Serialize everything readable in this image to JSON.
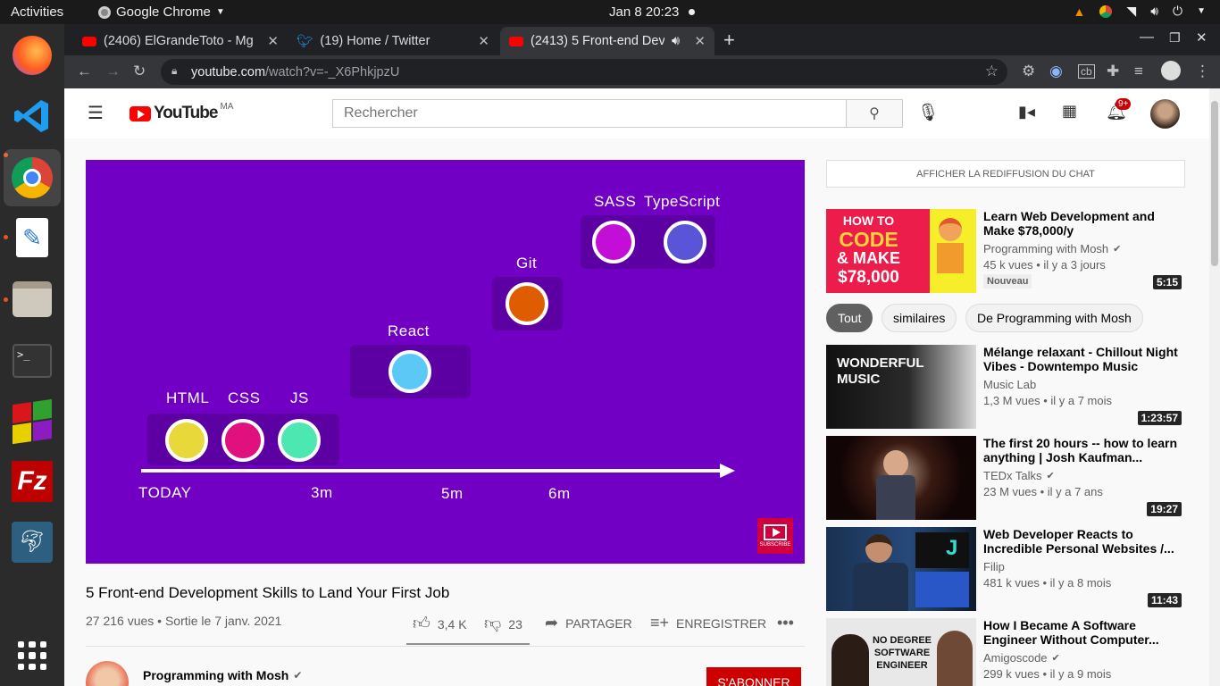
{
  "topbar": {
    "activities": "Activities",
    "app_name": "Google Chrome",
    "clock": "Jan 8  20:23"
  },
  "browser": {
    "tabs": [
      {
        "label": "(2406) ElGrandeToto - Mg",
        "icon": "youtube-icon"
      },
      {
        "label": "(19) Home / Twitter",
        "icon": "twitter-icon"
      },
      {
        "label": "(2413) 5 Front-end Dev",
        "icon": "youtube-icon",
        "active": true
      }
    ],
    "url_host": "youtube.com",
    "url_path": "/watch?v=-_X6PhkjpzU"
  },
  "youtube": {
    "logo": "YouTube",
    "region": "MA",
    "search_placeholder": "Rechercher",
    "notifications": "9+",
    "video": {
      "title": "5 Front-end Development Skills to Land Your First Job",
      "meta": "27 216 vues • Sortie le 7 janv. 2021",
      "likes": "3,4 K",
      "dislikes": "23",
      "share": "PARTAGER",
      "save": "ENREGISTRER",
      "channel": "Programming with Mosh",
      "subscribe": "S'ABONNER"
    },
    "player": {
      "labels": {
        "html": "HTML",
        "css": "CSS",
        "js": "JS",
        "react": "React",
        "git": "Git",
        "sass": "SASS",
        "ts": "TypeScript"
      },
      "timeline": {
        "today": "TODAY",
        "m3": "3m",
        "m5": "5m",
        "m6": "6m"
      },
      "subscribe_small": "SUBSCRIBE",
      "colors": {
        "bg": "#7100c4",
        "html": "#e8d83a",
        "css": "#e0107f",
        "js": "#4de8b2",
        "react": "#5bc8f5",
        "git": "#e05c00",
        "sass": "#c20ed6",
        "ts": "#5a55d6"
      }
    },
    "chat_button": "AFFICHER LA REDIFFUSION DU CHAT",
    "chips": [
      "Tout",
      "similaires",
      "De Programming with Mosh"
    ],
    "featured": {
      "title": "Learn Web Development and Make $78,000/y",
      "channel": "Programming with Mosh",
      "stats": "45 k vues • il y a 3 jours",
      "badge": "Nouveau",
      "duration": "5:15",
      "thumb_text": [
        "HOW TO",
        "CODE",
        "& MAKE",
        "$78,000"
      ]
    },
    "recommended": [
      {
        "title": "Mélange relaxant - Chillout Night Vibes - Downtempo Music",
        "channel": "Music Lab",
        "stats": "1,3 M vues • il y a 7 mois",
        "duration": "1:23:57",
        "thumb_text": "WONDERFUL MUSIC"
      },
      {
        "title": "The first 20 hours -- how to learn anything | Josh Kaufman...",
        "channel": "TEDx Talks",
        "stats": "23 M vues • il y a 7 ans",
        "duration": "19:27"
      },
      {
        "title": "Web Developer Reacts to Incredible Personal Websites /...",
        "channel": "Filip",
        "stats": "481 k vues • il y a 8 mois",
        "duration": "11:43"
      },
      {
        "title": "How I Became A Software Engineer Without Computer...",
        "channel": "Amigoscode",
        "stats": "299 k vues • il y a 9 mois",
        "duration": "",
        "thumb_text": "NO DEGREE SOFTWARE ENGINEER"
      }
    ]
  }
}
